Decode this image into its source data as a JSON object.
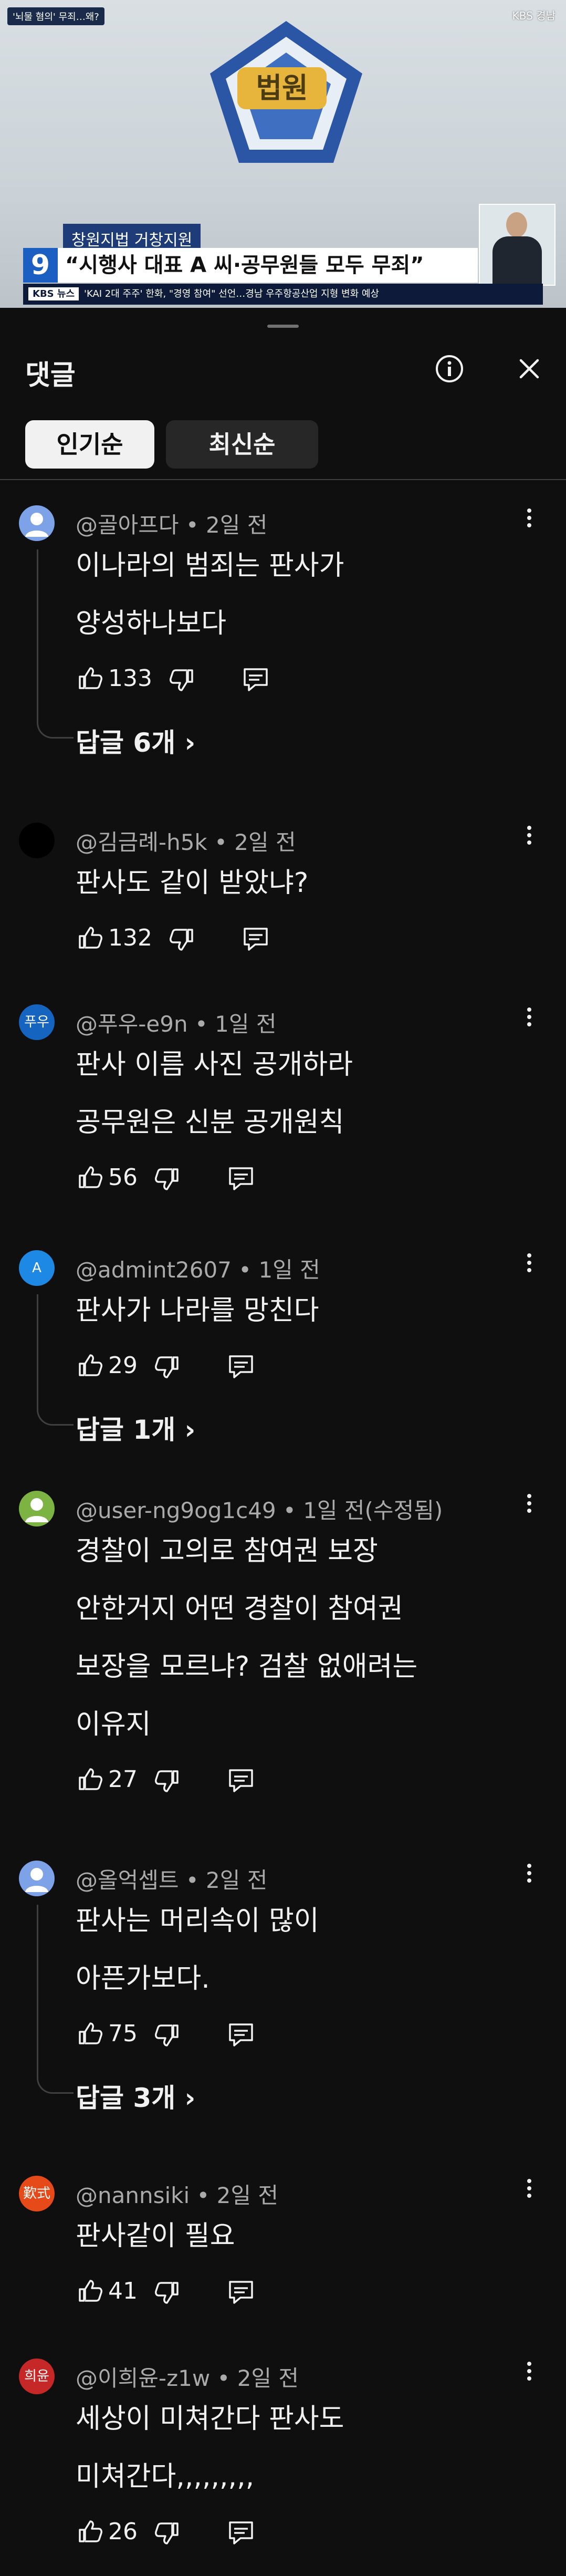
{
  "video": {
    "top_badge": "'뇌물 혐의' 무죄…왜?",
    "channel": "KBS 경남",
    "emblem_label": "법원",
    "caption_sub": "창원지법 거창지원",
    "caption_main": "“시행사 대표 A 씨·공무원들 모두 무죄”",
    "news_number": "9",
    "ticker_label": "KBS 뉴스",
    "ticker_text": "'KAI 2대 주주' 한화, \"경영 참여\" 선언…경남 우주항공산업 지형 변화 예상"
  },
  "header": {
    "title": "댓글",
    "info_icon": "info-icon",
    "close_icon": "close-icon"
  },
  "sort": {
    "popular": "인기순",
    "newest": "최신순"
  },
  "comments": [
    {
      "author": "@골아프다",
      "time": "2일 전",
      "lines": [
        "이나라의 범죄는 판사가",
        "양성하나보다"
      ],
      "likes": "133",
      "replies": "답글 6개 ›",
      "avatar_text": "",
      "avatar_color": "#7da2e8"
    },
    {
      "author": "@김금례-h5k",
      "time": "2일 전",
      "lines": [
        "판사도 같이 받았냐?"
      ],
      "likes": "132",
      "avatar_text": "",
      "avatar_color": "#000000"
    },
    {
      "author": "@푸우-e9n",
      "time": "1일 전",
      "lines": [
        "판사 이름 사진 공개하라",
        "공무원은 신분 공개원칙"
      ],
      "likes": "56",
      "avatar_text": "푸우",
      "avatar_color": "#1565c0"
    },
    {
      "author": "@admint2607",
      "time": "1일 전",
      "lines": [
        "판사가 나라를 망친다"
      ],
      "likes": "29",
      "replies": "답글 1개 ›",
      "avatar_text": "A",
      "avatar_color": "#1e88e5"
    },
    {
      "author": "@user-ng9og1c49",
      "time": "1일 전(수정됨)",
      "lines": [
        "경찰이 고의로 참여권 보장",
        "안한거지 어떤 경찰이 참여권",
        "보장을 모르냐? 검찰 없애려는",
        "이유지"
      ],
      "likes": "27",
      "avatar_text": "",
      "avatar_color": "#7cb342"
    },
    {
      "author": "@올억셉트",
      "time": "2일 전",
      "lines": [
        "판사는 머리속이 많이",
        "아픈가보다."
      ],
      "likes": "75",
      "replies": "답글 3개 ›",
      "avatar_text": "",
      "avatar_color": "#7da2e8"
    },
    {
      "author": "@nannsiki",
      "time": "2일 전",
      "lines": [
        "판사같이 필요"
      ],
      "likes": "41",
      "avatar_text": "歎式",
      "avatar_color": "#e64a19"
    },
    {
      "author": "@이희윤-z1w",
      "time": "2일 전",
      "lines": [
        "세상이 미쳐간다  판사도",
        "미쳐간다,,,,,,,,,"
      ],
      "likes": "26",
      "avatar_text": "희윤",
      "avatar_color": "#c62828"
    }
  ]
}
